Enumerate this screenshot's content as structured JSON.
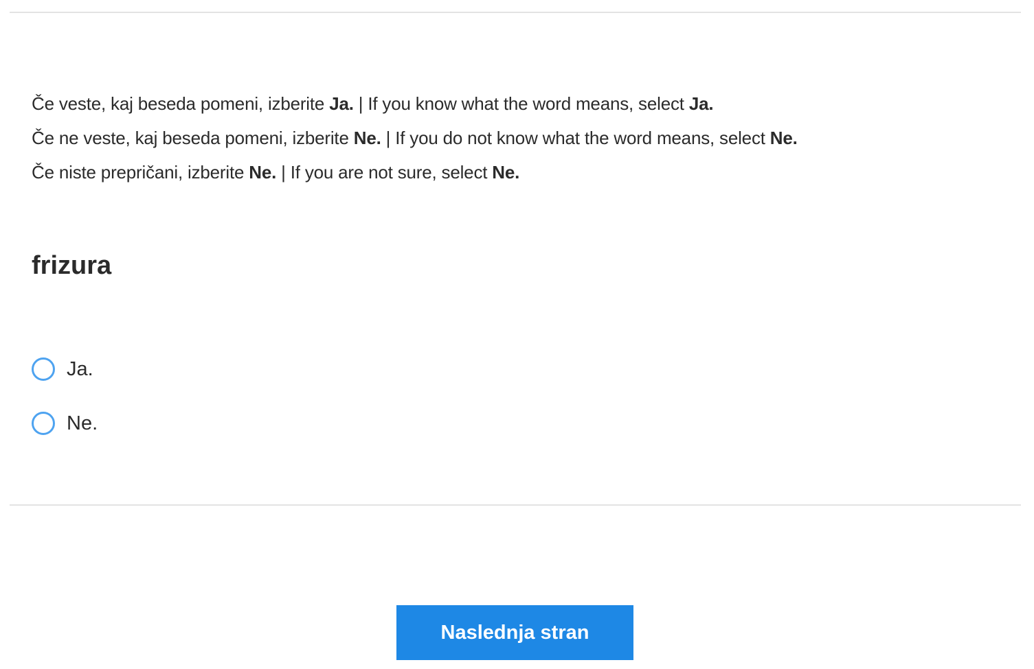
{
  "instructions": [
    {
      "sl_before": "Če veste, kaj beseda pomeni, izberite ",
      "sl_key": "Ja.",
      "en_before": " | If you know what the word means, select ",
      "en_key": "Ja."
    },
    {
      "sl_before": "Če ne veste, kaj beseda pomeni, izberite ",
      "sl_key": "Ne.",
      "en_before": " | If you do not know what the word means, select ",
      "en_key": "Ne."
    },
    {
      "sl_before": "Če niste prepričani, izberite ",
      "sl_key": "Ne.",
      "en_before": " | If you are not sure, select ",
      "en_key": "Ne."
    }
  ],
  "question": {
    "word": "frizura",
    "options": [
      {
        "label": "Ja.",
        "selected": false
      },
      {
        "label": "Ne.",
        "selected": false
      }
    ]
  },
  "footer": {
    "next_label": "Naslednja stran"
  },
  "colors": {
    "accent": "#1e88e5",
    "radio_border": "#4ea3f0",
    "divider": "#e3e3e3",
    "text": "#2b2b2b"
  }
}
